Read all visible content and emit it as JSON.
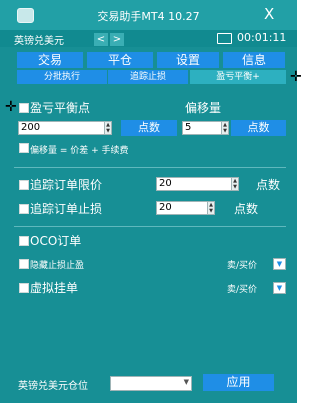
{
  "window": {
    "title": "交易助手MT4 10.27",
    "close_glyph": "X"
  },
  "toolbar": {
    "symbol": "英镑兑美元",
    "prev": "<",
    "next": ">",
    "timer": "00:01:11"
  },
  "tabs": [
    "交易",
    "平仓",
    "设置",
    "信息"
  ],
  "subtabs": [
    "分批执行",
    "追踪止损",
    "盈亏平衡+"
  ],
  "breakeven": {
    "label": "盈亏平衡点",
    "offset_label": "偏移量",
    "value": "200",
    "points_button": "点数",
    "offset_value": "5",
    "offset_points_button": "点数",
    "note": "偏移量 = 价差 + 手续费"
  },
  "trailing": {
    "limit_label": "追踪订单限价",
    "limit_value": "20",
    "limit_unit": "点数",
    "stop_label": "追踪订单止损",
    "stop_value": "20",
    "stop_unit": "点数"
  },
  "oco": {
    "label": "OCO订单",
    "hidden_label": "隐藏止损止盈",
    "hidden_side": "卖/买价",
    "virtual_label": "虚拟挂单",
    "virtual_side": "卖/买价"
  },
  "footer": {
    "position_label": "英镑兑美元仓位",
    "apply": "应用"
  },
  "cursors": [
    "✛",
    "✛"
  ],
  "icons": [
    "app-icon",
    "folder-icon",
    "close-icon",
    "dropdown-arrow-icon",
    "spin-up-icon",
    "spin-down-icon",
    "crosshair-cursor-icon"
  ]
}
